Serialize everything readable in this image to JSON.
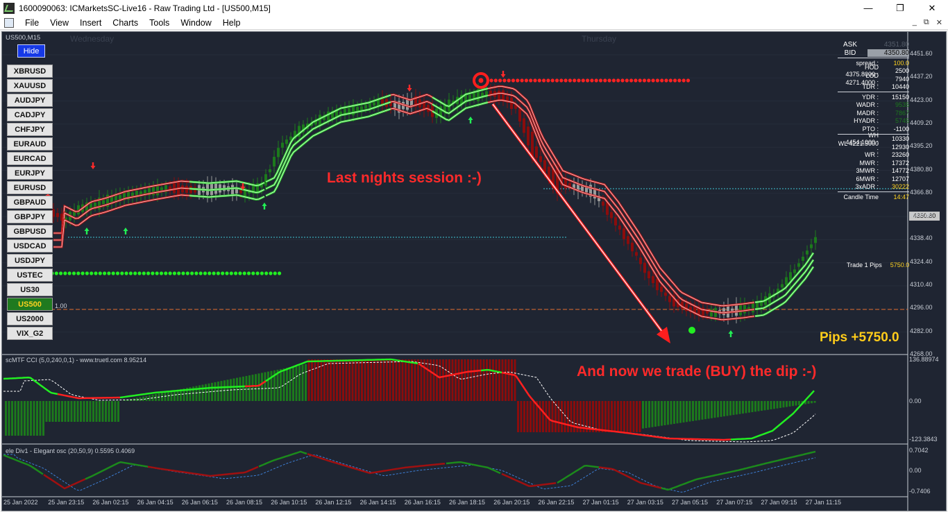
{
  "window": {
    "title": "1600090063: ICMarketsSC-Live16 - Raw Trading Ltd - [US500,M15]",
    "controls": [
      "—",
      "❐",
      "✕"
    ]
  },
  "menu": [
    "File",
    "View",
    "Insert",
    "Charts",
    "Tools",
    "Window",
    "Help"
  ],
  "mdi_controls": [
    "_",
    "⧉",
    "✕"
  ],
  "chart": {
    "symbol_label": "US500,M15",
    "days": [
      "Wednesday",
      "Thursday"
    ],
    "hide_label": "Hide",
    "symbols": [
      "XBRUSD",
      "XAUUSD",
      "AUDJPY",
      "CADJPY",
      "CHFJPY",
      "EURAUD",
      "EURCAD",
      "EURJPY",
      "EURUSD",
      "GBPAUD",
      "GBPJPY",
      "GBPUSD",
      "USDCAD",
      "USDJPY",
      "USTEC",
      "US30",
      "US500",
      "US2000",
      "VIX_G2"
    ],
    "active_symbol": "US500",
    "price_axis": [
      "4451.60",
      "4437.20",
      "4423.00",
      "4409.20",
      "4395.20",
      "4380.80",
      "4366.80",
      "4350.80",
      "4338.40",
      "4324.40",
      "4310.40",
      "4296.00",
      "4282.00",
      "4268.00"
    ],
    "current_price_badge": "4350.80",
    "hline_label": "1.00",
    "annotation_top": "Last nights session :-)",
    "annotation_bottom": "And now we trade (BUY) the dip :-)",
    "pips_label": "Pips +5750.0",
    "trade_label": "Trade 1 Pips",
    "trade_value": "5750.0"
  },
  "info_panel": {
    "ask_label": "ASK",
    "ask_value": "4351.80",
    "bid_label": "BID",
    "bid_value": "4350.80",
    "rows": [
      {
        "label": "spread :",
        "value": "100.0",
        "color": "#ffd21f"
      },
      {
        "label": "HOD 4375.8000 :",
        "value": "2500",
        "color": "#ffffff"
      },
      {
        "label": "LOD 4271.4000 :",
        "value": "7940",
        "color": "#ffffff"
      },
      {
        "label": "TDR :",
        "value": "10440",
        "color": "#ffffff"
      },
      {
        "label": "YDR :",
        "value": "15150",
        "color": "#ffffff"
      },
      {
        "label": "WADR :",
        "value": "9535",
        "color": "#1c7a1c"
      },
      {
        "label": "MADR :",
        "value": "7867",
        "color": "#1c7a1c"
      },
      {
        "label": "HYADR :",
        "value": "5745",
        "color": "#1c7a1c"
      },
      {
        "label": "PTO :",
        "value": "-1100",
        "color": "#ffffff"
      },
      {
        "label": "WH 4454.1000 :",
        "value": "10330",
        "color": "#ffffff"
      },
      {
        "label": "WL 4221.5000 :",
        "value": "12930",
        "color": "#ffffff"
      },
      {
        "label": "WR :",
        "value": "23260",
        "color": "#ffffff"
      },
      {
        "label": "MWR :",
        "value": "17372",
        "color": "#ffffff"
      },
      {
        "label": "3MWR :",
        "value": "14772",
        "color": "#ffffff"
      },
      {
        "label": "6MWR :",
        "value": "12707",
        "color": "#ffffff"
      },
      {
        "label": "3xADR :",
        "value": "30222",
        "color": "#ffd21f"
      },
      {
        "label": "Candle Time",
        "value": "14:47",
        "color": "#ffd21f"
      }
    ]
  },
  "cci": {
    "label": "scMTF CCI (5,0,240,0,1) - www.truetl.com 8.95214",
    "axis": [
      "136.88974",
      "0.00",
      "-123.3843"
    ]
  },
  "osc": {
    "label": "ele Div1 - Elegant osc (20,50,9) 0.5595 0.4069",
    "axis": [
      "0.7042",
      "0.00",
      "-0.7406"
    ]
  },
  "time_axis": [
    "25 Jan 2022",
    "25 Jan 23:15",
    "26 Jan 02:15",
    "26 Jan 04:15",
    "26 Jan 06:15",
    "26 Jan 08:15",
    "26 Jan 10:15",
    "26 Jan 12:15",
    "26 Jan 14:15",
    "26 Jan 16:15",
    "26 Jan 18:15",
    "26 Jan 20:15",
    "26 Jan 22:15",
    "27 Jan 01:15",
    "27 Jan 03:15",
    "27 Jan 05:15",
    "27 Jan 07:15",
    "27 Jan 09:15",
    "27 Jan 11:15"
  ],
  "colors": {
    "background": "#1f2532",
    "bull": "#1c7a1c",
    "bear": "#8b0c0c",
    "band_green": "#35d435",
    "band_red": "#c41d1d",
    "annotation": "#ff2a2a",
    "pips": "#ffcc1a"
  }
}
